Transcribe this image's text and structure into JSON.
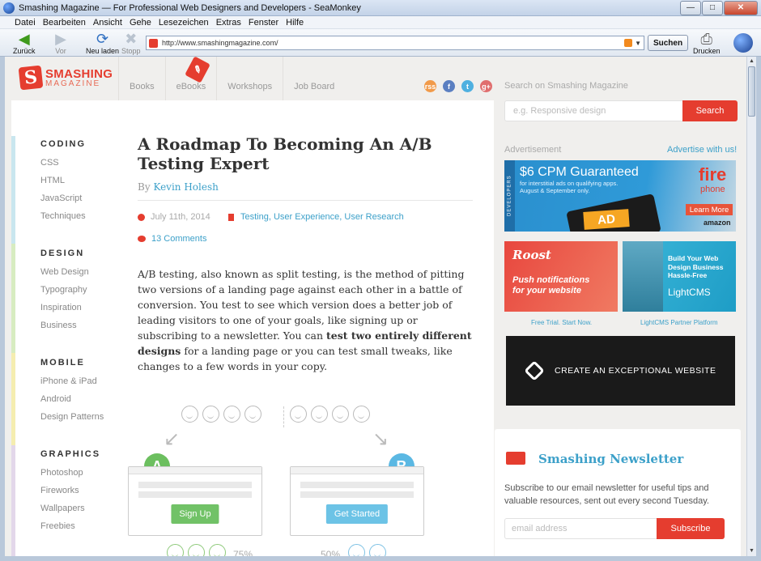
{
  "window": {
    "title": "Smashing Magazine — For Professional Web Designers and Developers - SeaMonkey",
    "min": "—",
    "max": "□",
    "close": "✕"
  },
  "menu": [
    "Datei",
    "Bearbeiten",
    "Ansicht",
    "Gehe",
    "Lesezeichen",
    "Extras",
    "Fenster",
    "Hilfe"
  ],
  "toolbar": {
    "back": "Zurück",
    "forward": "Vor",
    "reload": "Neu laden",
    "stop": "Stopp",
    "url": "http://www.smashingmagazine.com/",
    "search": "Suchen",
    "print": "Drucken"
  },
  "site": {
    "logo_line1": "SMASHING",
    "logo_line2": "MAGAZINE",
    "nav": [
      "Books",
      "eBooks",
      "Workshops",
      "Job Board"
    ],
    "social": [
      "rss",
      "f",
      "t",
      "g+"
    ]
  },
  "categories": [
    {
      "title": "CODING",
      "color": "#c9e6ef",
      "links": [
        "CSS",
        "HTML",
        "JavaScript",
        "Techniques"
      ]
    },
    {
      "title": "DESIGN",
      "color": "#d7ecc1",
      "links": [
        "Web Design",
        "Typography",
        "Inspiration",
        "Business"
      ]
    },
    {
      "title": "MOBILE",
      "color": "#f5edb0",
      "links": [
        "iPhone & iPad",
        "Android",
        "Design Patterns"
      ]
    },
    {
      "title": "GRAPHICS",
      "color": "#e3d7ea",
      "links": [
        "Photoshop",
        "Fireworks",
        "Wallpapers",
        "Freebies"
      ]
    }
  ],
  "article": {
    "title": "A Roadmap To Becoming An A/B Testing Expert",
    "by": "By",
    "author": "Kevin Holesh",
    "date": "July 11th, 2014",
    "tags": "Testing, User Experience, User Research",
    "comments": "13 Comments",
    "body_a": "A/B testing, also known as split testing, is the method of pitting two versions of a landing page against each other in a battle of conversion. You test to see which version does a better job of leading visitors to one of your goals, like signing up or subscribing to a newsletter. You can ",
    "body_bold": "test two entirely different designs",
    "body_b": " for a landing page or you can test small tweaks, like changes to a few words in your copy.",
    "illus": {
      "a": "A",
      "b": "B",
      "cta_a": "Sign Up",
      "cta_b": "Get Started",
      "pct_a": "75%",
      "pct_b": "50%"
    }
  },
  "sidebar": {
    "search_label": "Search on Smashing Magazine",
    "search_placeholder": "e.g. Responsive design",
    "search_button": "Search",
    "ad_label": "Advertisement",
    "advertise": "Advertise with us!",
    "ad1": {
      "developers": "DEVELOPERS",
      "headline": "$6 CPM Guaranteed",
      "sub": "for interstitial ads on qualifying apps. August & September only.",
      "ad": "AD",
      "fire": "fire",
      "phone": "phone",
      "learn": "Learn More",
      "amazon": "amazon"
    },
    "ad2": {
      "brand": "Roost",
      "text": "Push notifications for your website",
      "caption": "Free Trial. Start Now."
    },
    "ad3": {
      "text": "Build Your Web Design Business Hassle-Free",
      "brand": "LightCMS",
      "caption": "LightCMS Partner Platform"
    },
    "ad4": {
      "text": "CREATE AN EXCEPTIONAL WEBSITE"
    },
    "newsletter": {
      "title": "Smashing Newsletter",
      "desc": "Subscribe to our email newsletter for useful tips and valuable resources, sent out every second Tuesday.",
      "placeholder": "email address",
      "button": "Subscribe"
    }
  }
}
